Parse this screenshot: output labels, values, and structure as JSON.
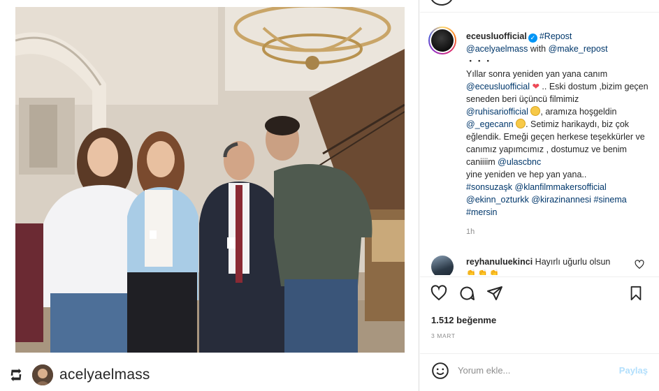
{
  "photo": {
    "alt_icon": "group-photo"
  },
  "repost": {
    "username": "acelyaelmass",
    "icon": "repost-icon"
  },
  "caption": {
    "username": "eceusluofficial",
    "hashtag_repost": "#Repost",
    "mention_reposter": "@acelyaelmass",
    "with_text": " with ",
    "mention_app": "@make_repost",
    "dots": "・・・",
    "line1": "Yıllar sonra yeniden yan yana canım",
    "mention1": "@eceusluofficial",
    "text2": " .. Eski dostum ,bizim geçen seneden beri üçüncü filmimiz",
    "mention2": "@ruhisariofficial",
    "text3": ", aramıza hoşgeldin",
    "mention3": "@_egecann",
    "text4": ". Setimiz harikaydı, biz çok eğlendik. Emeği geçen herkese teşekkürler ve canımız yapımcımız , dostumuz ve benim caniiiim",
    "mention4": "@ulascbnc",
    "text5": "yine yeniden ve hep yan yana..",
    "tag1": "#sonsuzaşk",
    "tag2": "@klanfilmmakersofficial",
    "tag3": "@ekinn_ozturkk",
    "tag4": "@kirazinannesi",
    "tag5": "#sinema",
    "tag6": "#mersin",
    "time": "1h"
  },
  "comment": {
    "username": "reyhanuluekinci",
    "text": "Hayırlı uğurlu olsun",
    "emoji": "👏👏👏"
  },
  "likes": "1.512 beğenme",
  "date": "3 MART",
  "comment_box": {
    "placeholder": "Yorum ekle...",
    "post_label": "Paylaş"
  },
  "colors": {
    "link": "#00376b",
    "verified": "#0095f6",
    "post_disabled": "#b2dffc",
    "heart": "#ed4956"
  }
}
